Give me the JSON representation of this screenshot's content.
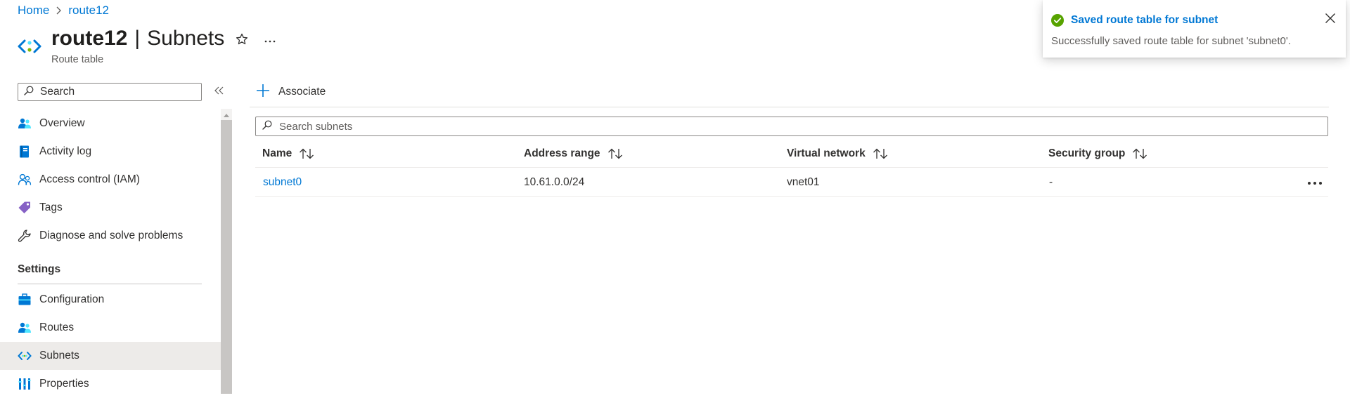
{
  "breadcrumb": {
    "home": "Home",
    "current": "route12"
  },
  "header": {
    "resource_name": "route12",
    "separator": "|",
    "page_name": "Subnets",
    "subtitle": "Route table",
    "star_icon": "star-icon",
    "more_icon": "ellipsis-icon"
  },
  "sidebar": {
    "search_placeholder": "Search",
    "collapse_icon": "double-chevron-left-icon",
    "items": [
      {
        "label": "Overview",
        "icon": "people-icon"
      },
      {
        "label": "Activity log",
        "icon": "log-book-icon"
      },
      {
        "label": "Access control (IAM)",
        "icon": "users-icon"
      },
      {
        "label": "Tags",
        "icon": "tag-icon"
      },
      {
        "label": "Diagnose and solve problems",
        "icon": "wrench-icon"
      }
    ],
    "settings_header": "Settings",
    "settings_items": [
      {
        "label": "Configuration",
        "icon": "toolbox-icon"
      },
      {
        "label": "Routes",
        "icon": "people-icon"
      },
      {
        "label": "Subnets",
        "icon": "subnet-icon",
        "active": true
      },
      {
        "label": "Properties",
        "icon": "properties-icon"
      }
    ]
  },
  "toolbar": {
    "associate_label": "Associate"
  },
  "grid": {
    "search_placeholder": "Search subnets",
    "columns": [
      {
        "label": "Name"
      },
      {
        "label": "Address range"
      },
      {
        "label": "Virtual network"
      },
      {
        "label": "Security group"
      }
    ],
    "rows": [
      {
        "name": "subnet0",
        "address_range": "10.61.0.0/24",
        "virtual_network": "vnet01",
        "security_group": "-"
      }
    ]
  },
  "toast": {
    "title": "Saved route table for subnet",
    "message": "Successfully saved route table for subnet 'subnet0'.",
    "status_color": "#57a300"
  },
  "colors": {
    "accent": "#0078d4",
    "active_nav": "#edebe9",
    "scrollbar": "#c8c6c4"
  }
}
